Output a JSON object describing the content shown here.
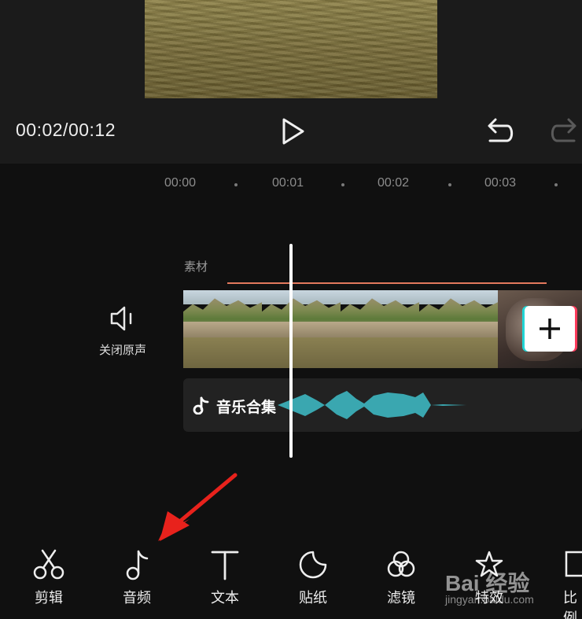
{
  "player": {
    "time": "00:02/00:12"
  },
  "ruler": {
    "ticks": [
      "00:00",
      "00:01",
      "00:02",
      "00:03"
    ]
  },
  "track": {
    "label": "素材",
    "mute_label": "关闭原声"
  },
  "music": {
    "label": "音乐合集"
  },
  "colors": {
    "accent_line": "#e3795d",
    "waveform": "#3aa7b0",
    "add_left": "#20d5d5",
    "add_right": "#ff3b5c"
  },
  "tools": [
    {
      "label": "剪辑",
      "icon": "scissors-icon"
    },
    {
      "label": "音频",
      "icon": "music-note-icon"
    },
    {
      "label": "文本",
      "icon": "text-icon"
    },
    {
      "label": "贴纸",
      "icon": "sticker-icon"
    },
    {
      "label": "滤镜",
      "icon": "filter-icon"
    },
    {
      "label": "特效",
      "icon": "effects-icon"
    },
    {
      "label": "比例",
      "icon": "ratio-icon"
    }
  ],
  "watermark": {
    "brand": "Bai 经验",
    "url": "jingyan.baidu.com"
  }
}
